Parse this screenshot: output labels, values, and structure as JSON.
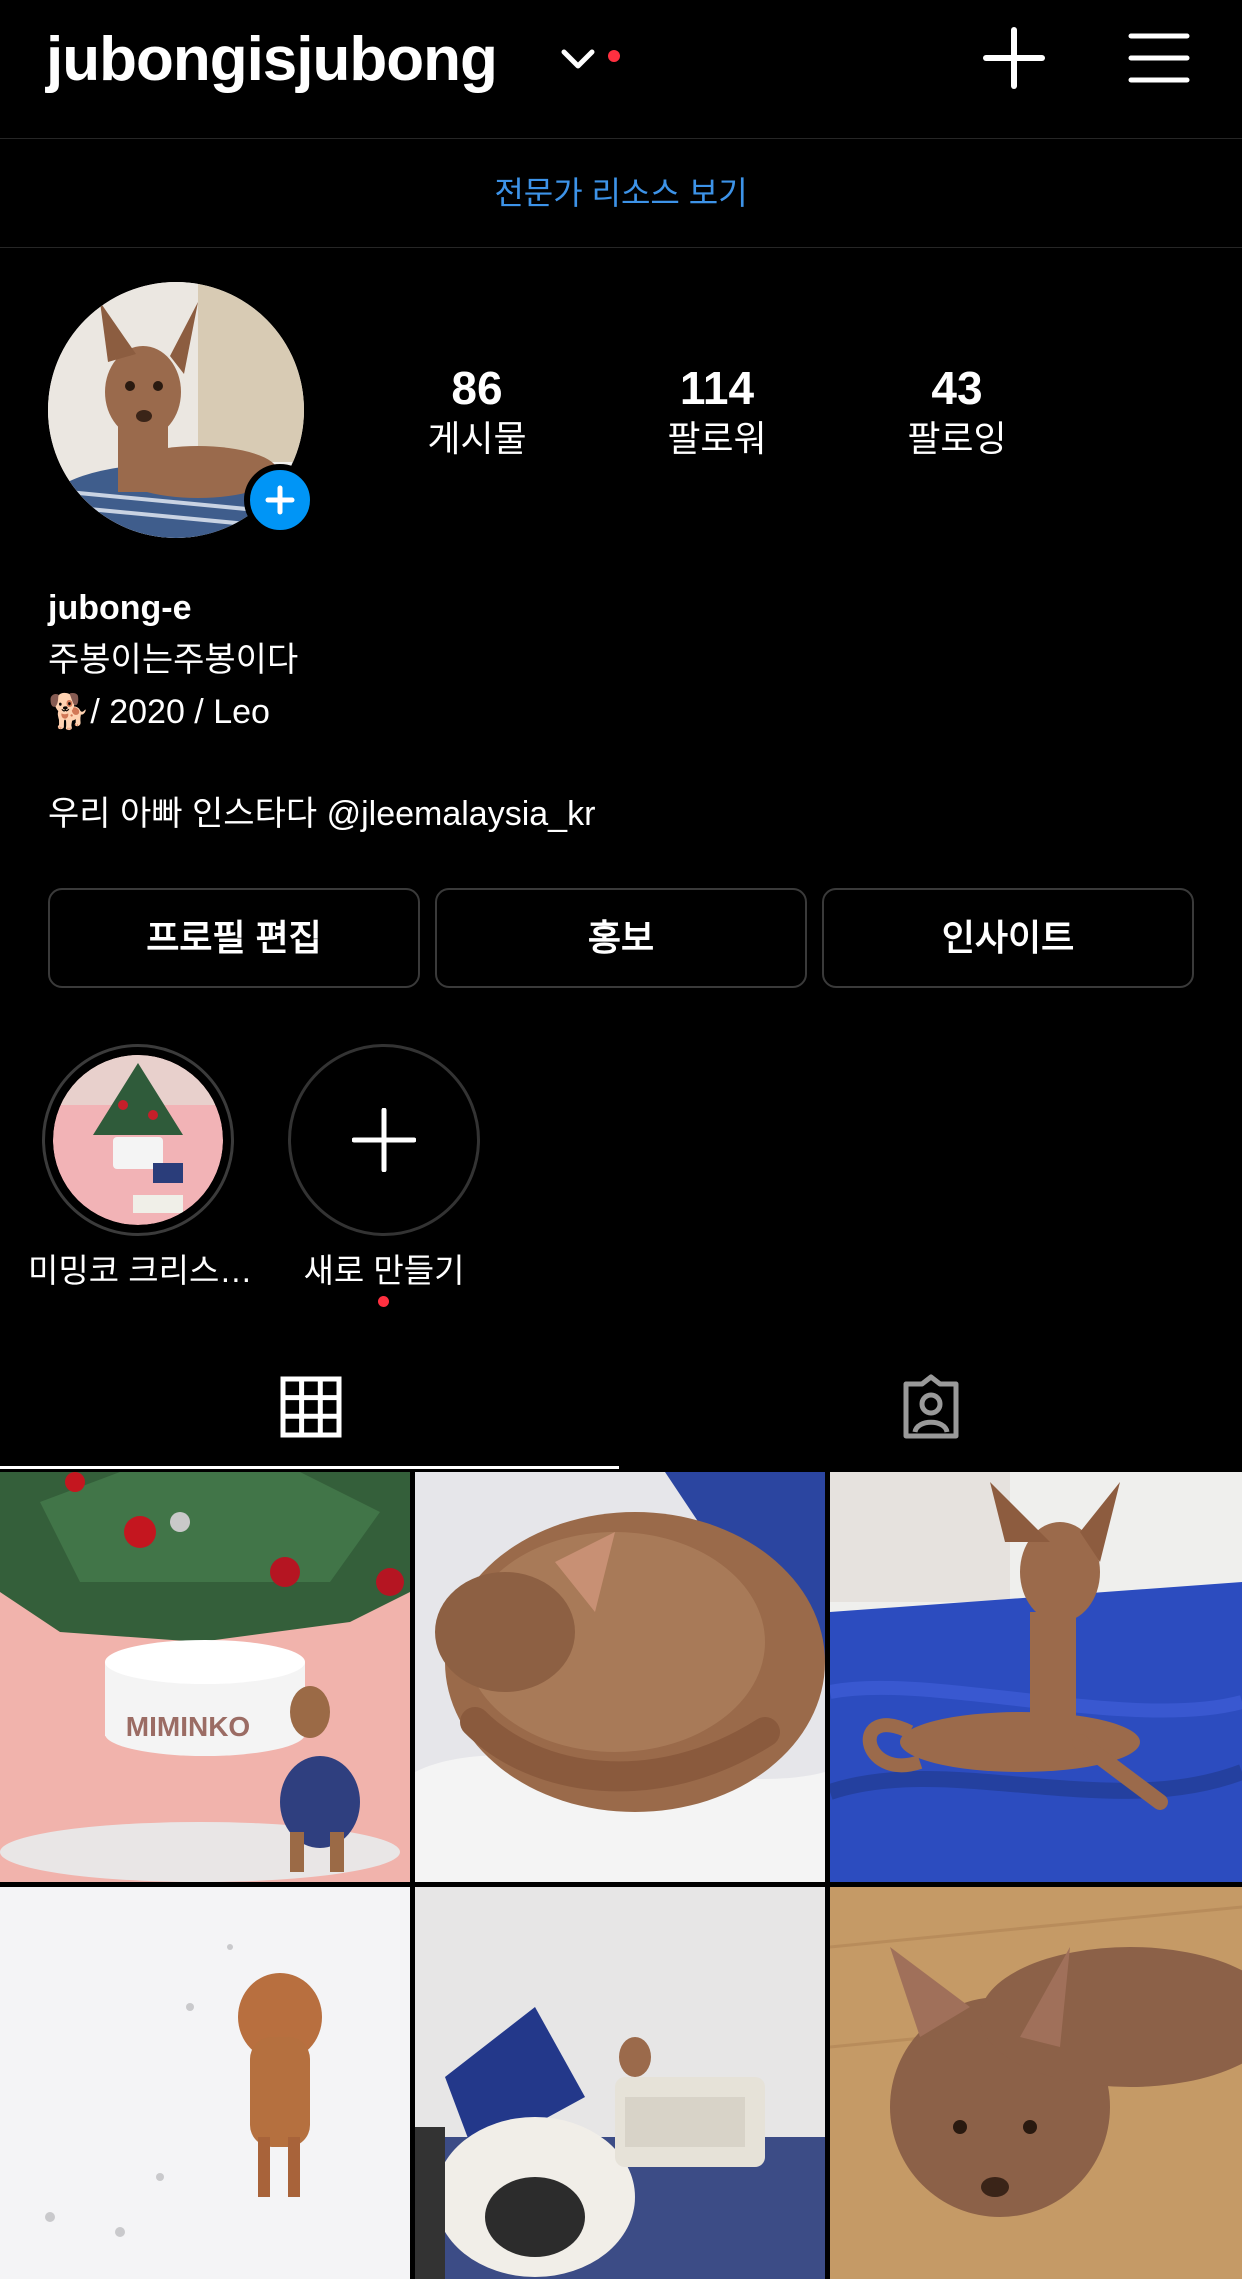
{
  "header": {
    "username": "jubongisjubong",
    "create_icon": "plus-icon",
    "menu_icon": "hamburger-menu-icon"
  },
  "resources_link": "전문가 리소스 보기",
  "profile": {
    "stats": [
      {
        "value": "86",
        "label": "게시물"
      },
      {
        "value": "114",
        "label": "팔로워"
      },
      {
        "value": "43",
        "label": "팔로잉"
      }
    ],
    "display_name": "jubong-e",
    "bio_line1": "주봉이는주봉이다",
    "bio_line2": "🐕/ 2020 / Leo",
    "bio_line3": "우리 아빠 인스타다 @jleemalaysia_kr"
  },
  "buttons": {
    "edit_profile": "프로필 편집",
    "promote": "홍보",
    "insights": "인사이트"
  },
  "highlights": [
    {
      "label": "미밍코 크리스…"
    },
    {
      "label": "새로 만들기"
    }
  ],
  "grid_tile_texts": {
    "miminko": "MIMINKO"
  },
  "colors": {
    "accent_blue": "#0095f6",
    "link_blue": "#3d93e8",
    "notification_red": "#ff3040",
    "background": "#000000"
  }
}
